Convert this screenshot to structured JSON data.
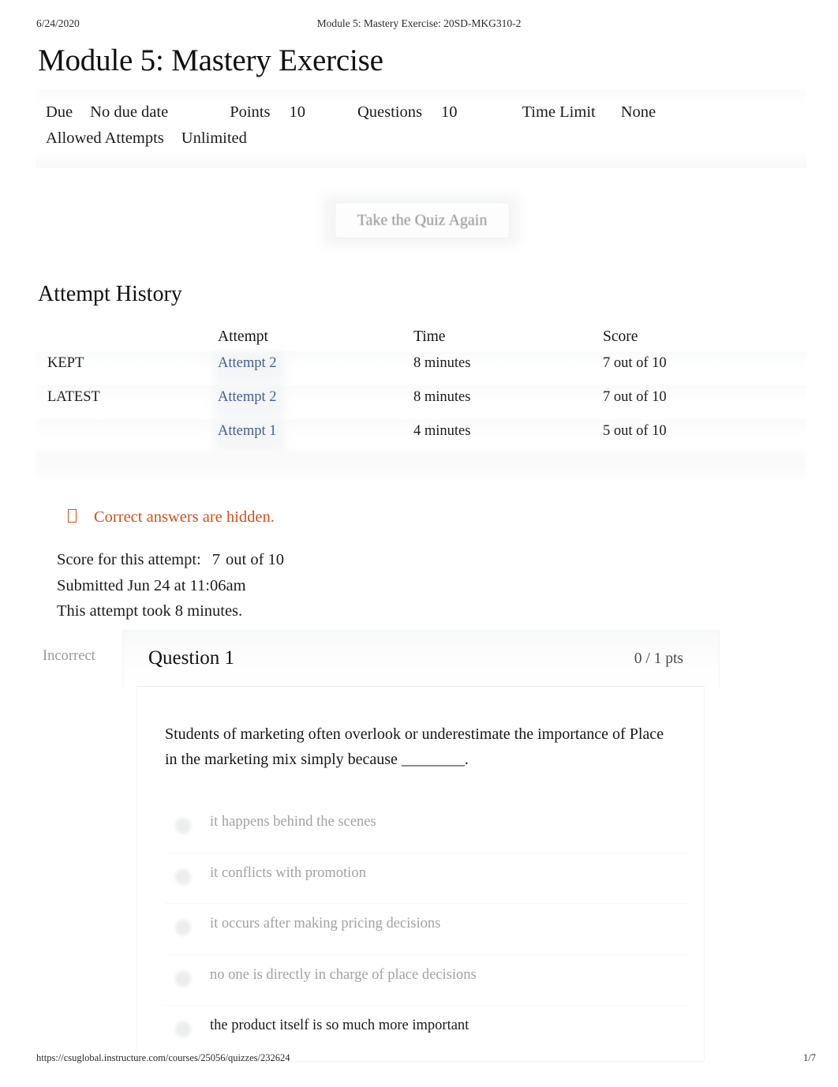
{
  "print": {
    "date": "6/24/2020",
    "header_title": "Module 5: Mastery Exercise: 20SD-MKG310-2",
    "footer_url": "https://csuglobal.instructure.com/courses/25056/quizzes/232624",
    "page_number": "1/7"
  },
  "page": {
    "title": "Module 5: Mastery Exercise"
  },
  "details": {
    "due_label": "Due",
    "due_value": "No due date",
    "points_label": "Points",
    "points_value": "10",
    "questions_label": "Questions",
    "questions_value": "10",
    "time_limit_label": "Time Limit",
    "time_limit_value": "None",
    "attempts_label": "Allowed Attempts",
    "attempts_value": "Unlimited"
  },
  "actions": {
    "take_quiz_again": "Take the Quiz Again"
  },
  "attempt_history": {
    "heading": "Attempt History",
    "columns": [
      "",
      "Attempt",
      "Time",
      "Score"
    ],
    "rows": [
      {
        "status": "KEPT",
        "attempt": "Attempt 2",
        "time": "8 minutes",
        "score": "7 out of 10"
      },
      {
        "status": "LATEST",
        "attempt": "Attempt 2",
        "time": "8 minutes",
        "score": "7 out of 10"
      },
      {
        "status": "",
        "attempt": "Attempt 1",
        "time": "4 minutes",
        "score": "5 out of 10"
      }
    ]
  },
  "notice": {
    "text": "Correct answers are hidden.",
    "color": "#d1501c",
    "icon": "info-icon"
  },
  "attempt_summary": {
    "score_label": "Score for this attempt:",
    "score_value": "7",
    "score_suffix": "out of 10",
    "submitted": "Submitted Jun 24 at 11:06am",
    "duration": "This attempt took 8 minutes."
  },
  "question": {
    "verdict": "Incorrect",
    "title": "Question 1",
    "points": "0 / 1 pts",
    "text": "Students of marketing often overlook or underestimate the importance of Place in the marketing mix simply because ________.",
    "answers": [
      {
        "label": "it happens behind the scenes",
        "selected": false
      },
      {
        "label": "it conflicts with promotion",
        "selected": false
      },
      {
        "label": "it occurs after making pricing decisions",
        "selected": false
      },
      {
        "label": "no one is directly in charge of place decisions",
        "selected": false
      },
      {
        "label": "the product itself is so much more important",
        "selected": true
      }
    ]
  }
}
